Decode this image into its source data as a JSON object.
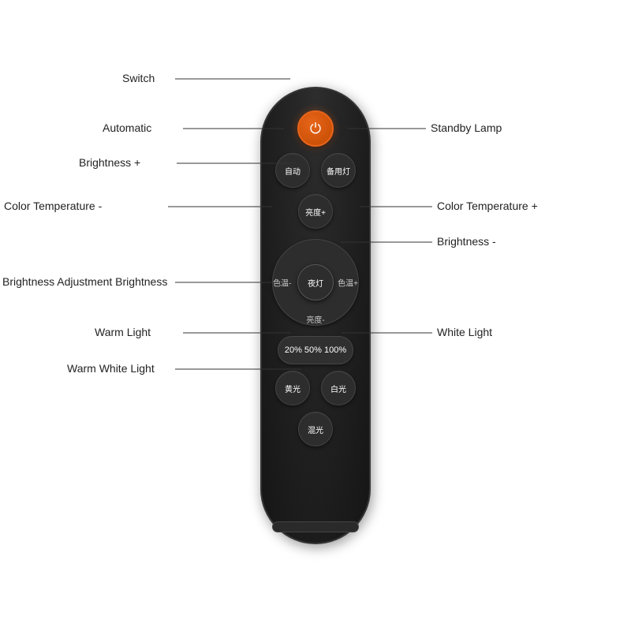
{
  "remote": {
    "buttons": {
      "power": "⏻",
      "auto": "自动",
      "standby": "备用灯",
      "brightness_plus": "亮度+",
      "night": "夜灯",
      "color_temp_minus": "色温-",
      "color_temp_plus": "色温+",
      "brightness_minus": "亮度-",
      "percent": "20% 50% 100%",
      "warm_light": "黄光",
      "white_light": "白光",
      "warm_white": "混光"
    }
  },
  "annotations": {
    "switch": "Switch",
    "automatic": "Automatic",
    "standby_lamp": "Standby Lamp",
    "brightness_plus": "Brightness +",
    "color_temp_minus": "Color Temperature -",
    "color_temp_plus": "Color Temperature +",
    "brightness_minus": "Brightness -",
    "brightness_adj": "Brightness Adjustment Brightness",
    "warm_light": "Warm Light",
    "white_light": "White Light",
    "warm_white_light": "Warm White Light"
  }
}
